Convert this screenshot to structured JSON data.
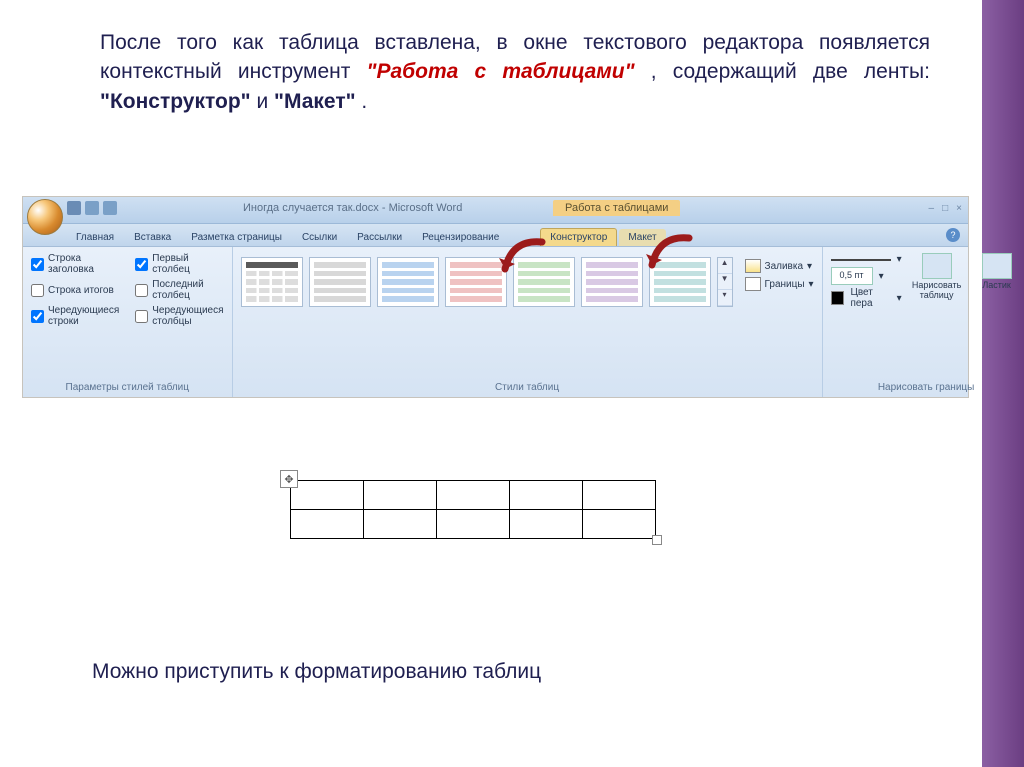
{
  "intro": {
    "part1": "После того как таблица вставлена, в окне текстового редактора появляется контекстный инструмент ",
    "highlight1": "\"Работа с таблицами\"",
    "part2": ", содержащий две ленты: ",
    "bold1": "\"Конструктор\"",
    "part3": " и ",
    "bold2": "\"Макет\"",
    "part4": "."
  },
  "titlebar": {
    "doc_title": "Иногда случается так.docx - Microsoft Word",
    "context_title": "Работа с таблицами"
  },
  "tabs": {
    "home": "Главная",
    "insert": "Вставка",
    "page_layout": "Разметка страницы",
    "references": "Ссылки",
    "mailings": "Рассылки",
    "review": "Рецензирование",
    "design": "Конструктор",
    "layout": "Макет"
  },
  "style_options": {
    "header_row": "Строка заголовка",
    "total_row": "Строка итогов",
    "banded_rows": "Чередующиеся строки",
    "first_col": "Первый столбец",
    "last_col": "Последний столбец",
    "banded_cols": "Чередующиеся столбцы",
    "group_label": "Параметры стилей таблиц"
  },
  "styles_group_label": "Стили таблиц",
  "shading": {
    "fill": "Заливка",
    "borders": "Границы"
  },
  "draw_group": {
    "weight": "0,5 пт",
    "pen_color": "Цвет пера",
    "draw_table": "Нарисовать таблицу",
    "eraser": "Ластик",
    "group_label": "Нарисовать границы"
  },
  "bottom_text": "Можно приступить к форматированию таблиц"
}
